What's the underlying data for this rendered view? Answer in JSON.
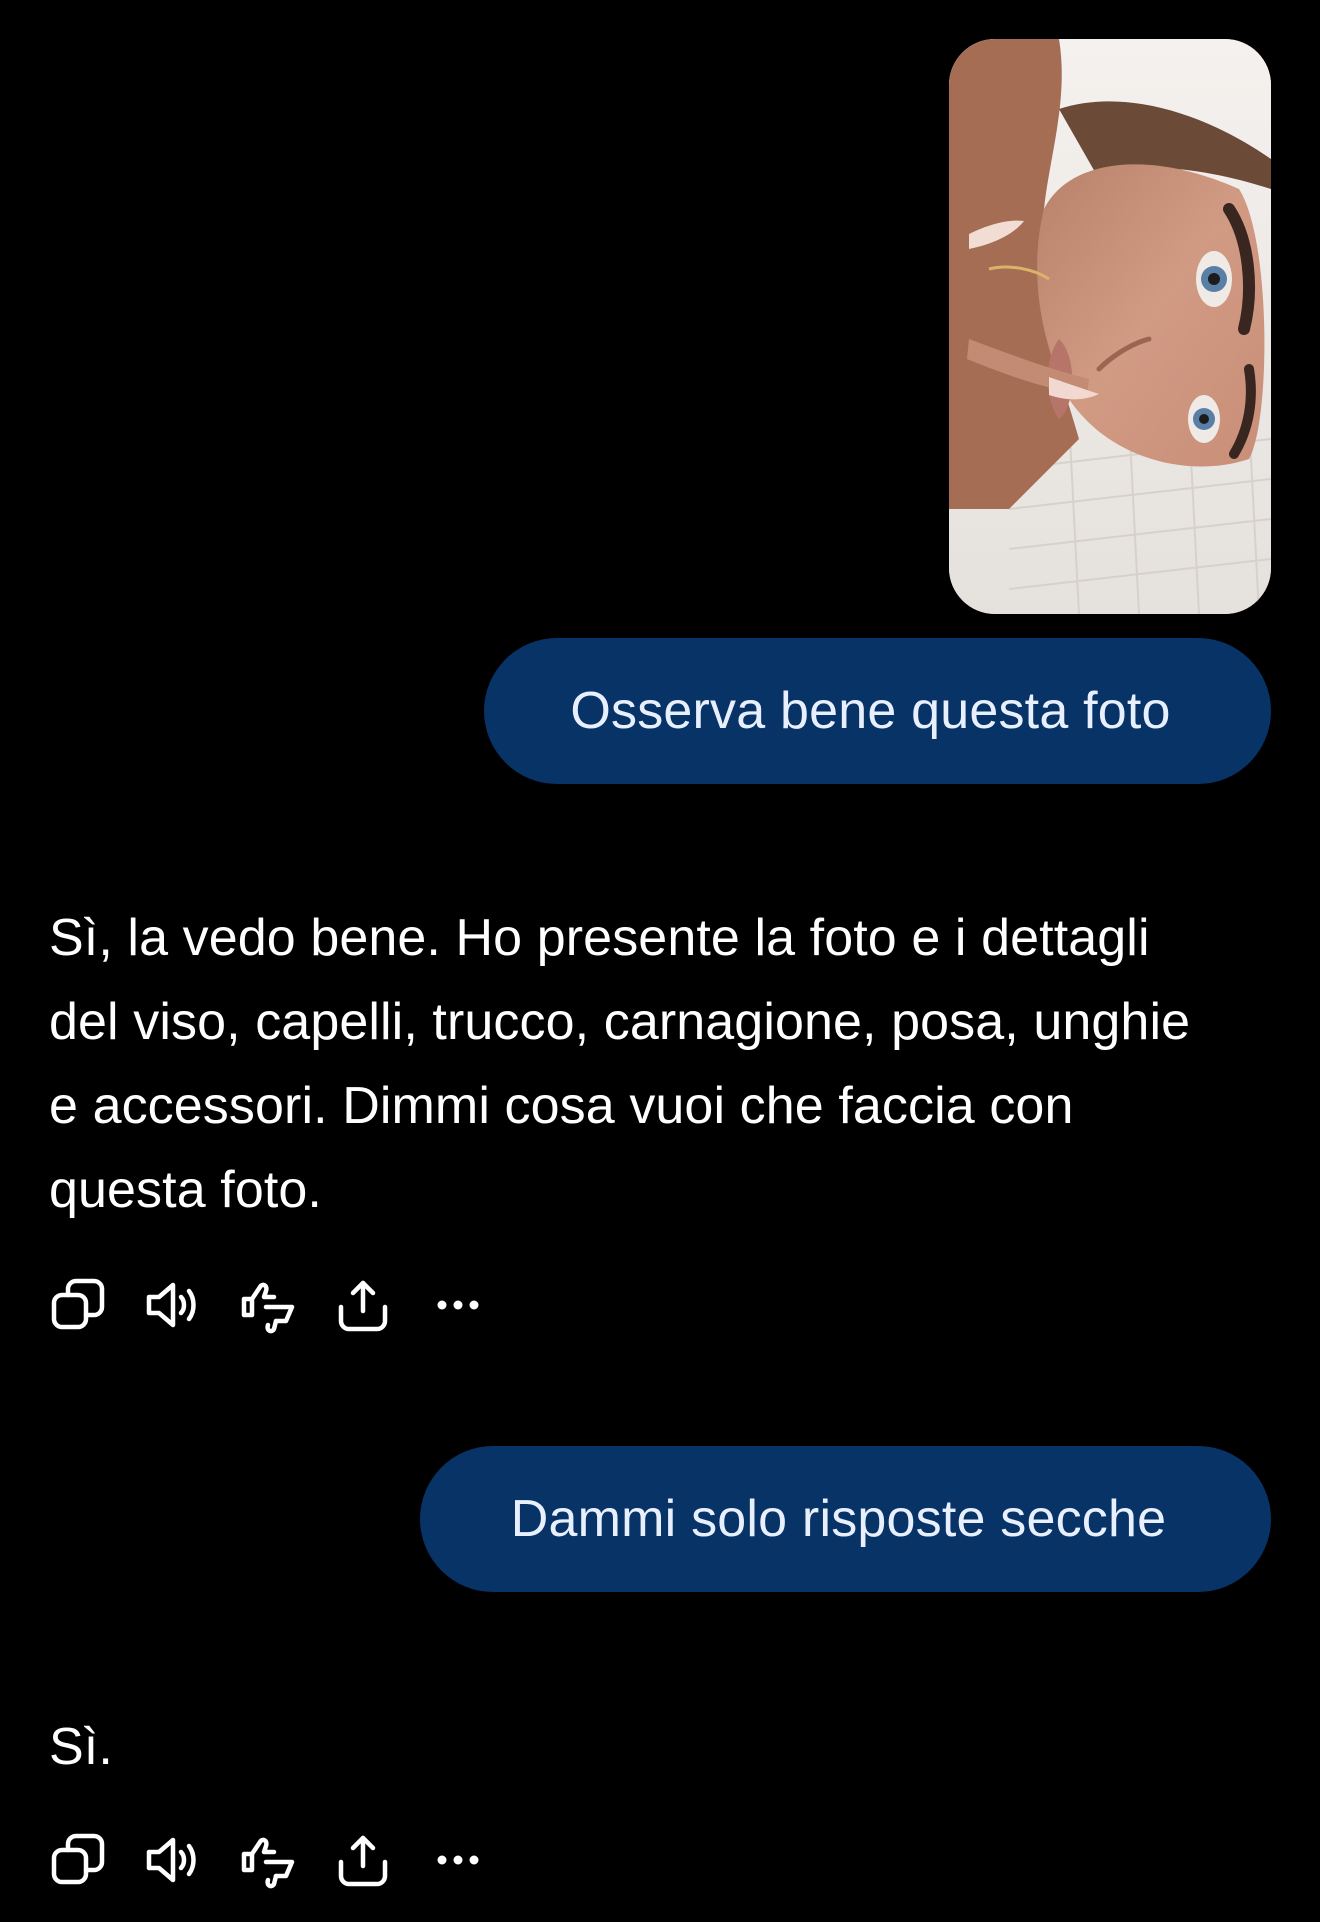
{
  "conversation": {
    "messages": [
      {
        "role": "user",
        "type": "image",
        "image": {
          "subject": "selfie-photo"
        }
      },
      {
        "role": "user",
        "type": "text",
        "text": "Osserva bene questa foto"
      },
      {
        "role": "assistant",
        "type": "text",
        "text": "Sì, la vedo bene. Ho presente la foto e i dettagli del viso, capelli, trucco, carnagione, posa, unghie e accessori. Dimmi cosa vuoi che faccia con questa foto."
      },
      {
        "role": "user",
        "type": "text",
        "text": "Dammi solo risposte secche"
      },
      {
        "role": "assistant",
        "type": "text",
        "text": "Sì."
      }
    ]
  },
  "action_icons": [
    "copy-icon",
    "read-aloud-icon",
    "feedback-thumbs-icon",
    "share-icon",
    "more-icon"
  ],
  "colors": {
    "background": "#000000",
    "user_bubble": "#083366",
    "user_text": "#e8f0ff",
    "assistant_text": "#ffffff"
  }
}
